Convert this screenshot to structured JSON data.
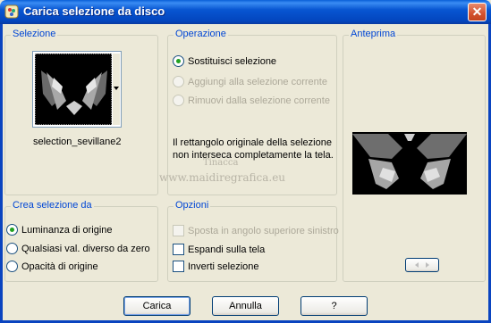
{
  "window": {
    "title": "Carica selezione da disco",
    "close_glyph": "✕",
    "icon": "psp-app-icon"
  },
  "selezione": {
    "title": "Selezione",
    "thumbnail_name": "selection_sevillane2"
  },
  "operazione": {
    "title": "Operazione",
    "options": [
      {
        "label": "Sostituisci selezione",
        "selected": true,
        "enabled": true
      },
      {
        "label": "Aggiungi alla selezione corrente",
        "selected": false,
        "enabled": false
      },
      {
        "label": "Rimuovi dalla selezione corrente",
        "selected": false,
        "enabled": false
      }
    ],
    "message": "Il rettangolo originale della selezione non interseca completamente la tela."
  },
  "anteprima": {
    "title": "Anteprima"
  },
  "crea_selezione": {
    "title": "Crea selezione da",
    "options": [
      {
        "label": "Luminanza di origine",
        "selected": true
      },
      {
        "label": "Qualsiasi val. diverso da zero",
        "selected": false
      },
      {
        "label": "Opacità di origine",
        "selected": false
      }
    ]
  },
  "opzioni": {
    "title": "Opzioni",
    "checkboxes": [
      {
        "label": "Sposta in angolo superiore sinistro",
        "checked": false,
        "enabled": false
      },
      {
        "label": "Espandi sulla tela",
        "checked": false,
        "enabled": true
      },
      {
        "label": "Inverti selezione",
        "checked": false,
        "enabled": true
      }
    ]
  },
  "watermark": {
    "line1": "Tinacca",
    "line2": "www.maidiregrafica.eu"
  },
  "buttons": {
    "carica": "Carica",
    "annulla": "Annulla",
    "help": "?"
  },
  "colors": {
    "title_bar": "#0a5fd8",
    "group_title": "#0046d5",
    "dialog_bg": "#ece9d8",
    "radio_dot": "#21a121"
  }
}
